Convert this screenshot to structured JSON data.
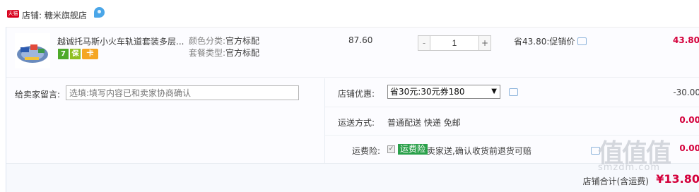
{
  "shop": {
    "badge": "天猫",
    "label": "店铺:",
    "name": "糖米旗舰店"
  },
  "item": {
    "title": "越诚托马斯小火车轨道套装多层...",
    "services": [
      "7",
      "保",
      "卡"
    ],
    "sku": [
      {
        "key": "颜色分类:",
        "value": "官方标配"
      },
      {
        "key": "套餐类型:",
        "value": "官方标配"
      }
    ],
    "unit_price": "87.60",
    "qty_minus": "-",
    "qty": "1",
    "qty_plus": "+",
    "promo": "省43.80:促销价",
    "total": "43.80"
  },
  "note": {
    "label": "给卖家留言:",
    "placeholder": "选填:填写内容已和卖家协商确认"
  },
  "coupon": {
    "label": "店铺优惠:",
    "selected": "省30元:30元券180",
    "arrow": "▼",
    "value": "-30.00"
  },
  "shipping": {
    "label": "运送方式:",
    "text": "普通配送 快递 免邮",
    "value": "0.00"
  },
  "insurance": {
    "label": "运费险:",
    "check": "✓",
    "badge": "运费险",
    "text": "卖家送,确认收货前退货可赔",
    "value": "0.00"
  },
  "summary": {
    "label": "店铺合计(含运费)",
    "value": "¥13.80"
  },
  "watermark": {
    "text": "值值值",
    "sub": "smzdm.com"
  },
  "colors": {
    "price_red": "#d4003b",
    "tmall_red": "#d8001c",
    "ww_blue": "#4aa6e8",
    "ins_green": "#2aa04a"
  }
}
